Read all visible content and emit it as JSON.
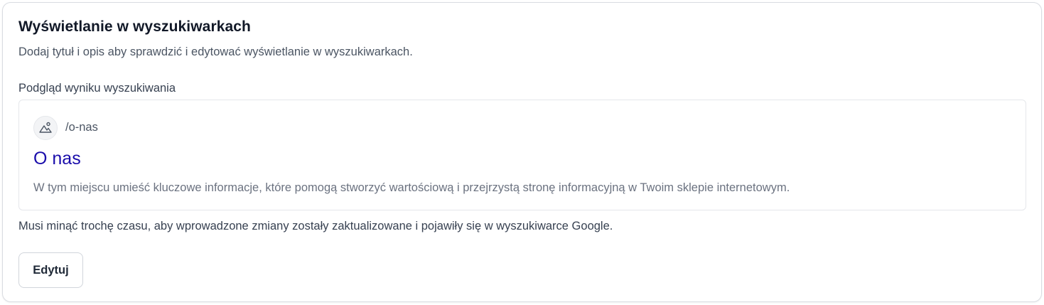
{
  "section": {
    "title": "Wyświetlanie w wyszukiwarkach",
    "subtitle": "Dodaj tytuł i opis aby sprawdzić i edytować wyświetlanie w wyszukiwarkach."
  },
  "preview": {
    "label": "Podgląd wyniku wyszukiwania",
    "favicon_icon": "image-placeholder-icon",
    "url": "/o-nas",
    "title": "O nas",
    "description": "W tym miejscu umieść kluczowe informacje, które pomogą stworzyć wartościową i przejrzystą stronę informacyjną w Twoim sklepie internetowym.",
    "title_color": "#1a0dab"
  },
  "note": "Musi minąć trochę czasu, aby wprowadzone zmiany zostały zaktualizowane i pojawiły się w wyszukiwarce Google.",
  "actions": {
    "edit_label": "Edytuj"
  }
}
